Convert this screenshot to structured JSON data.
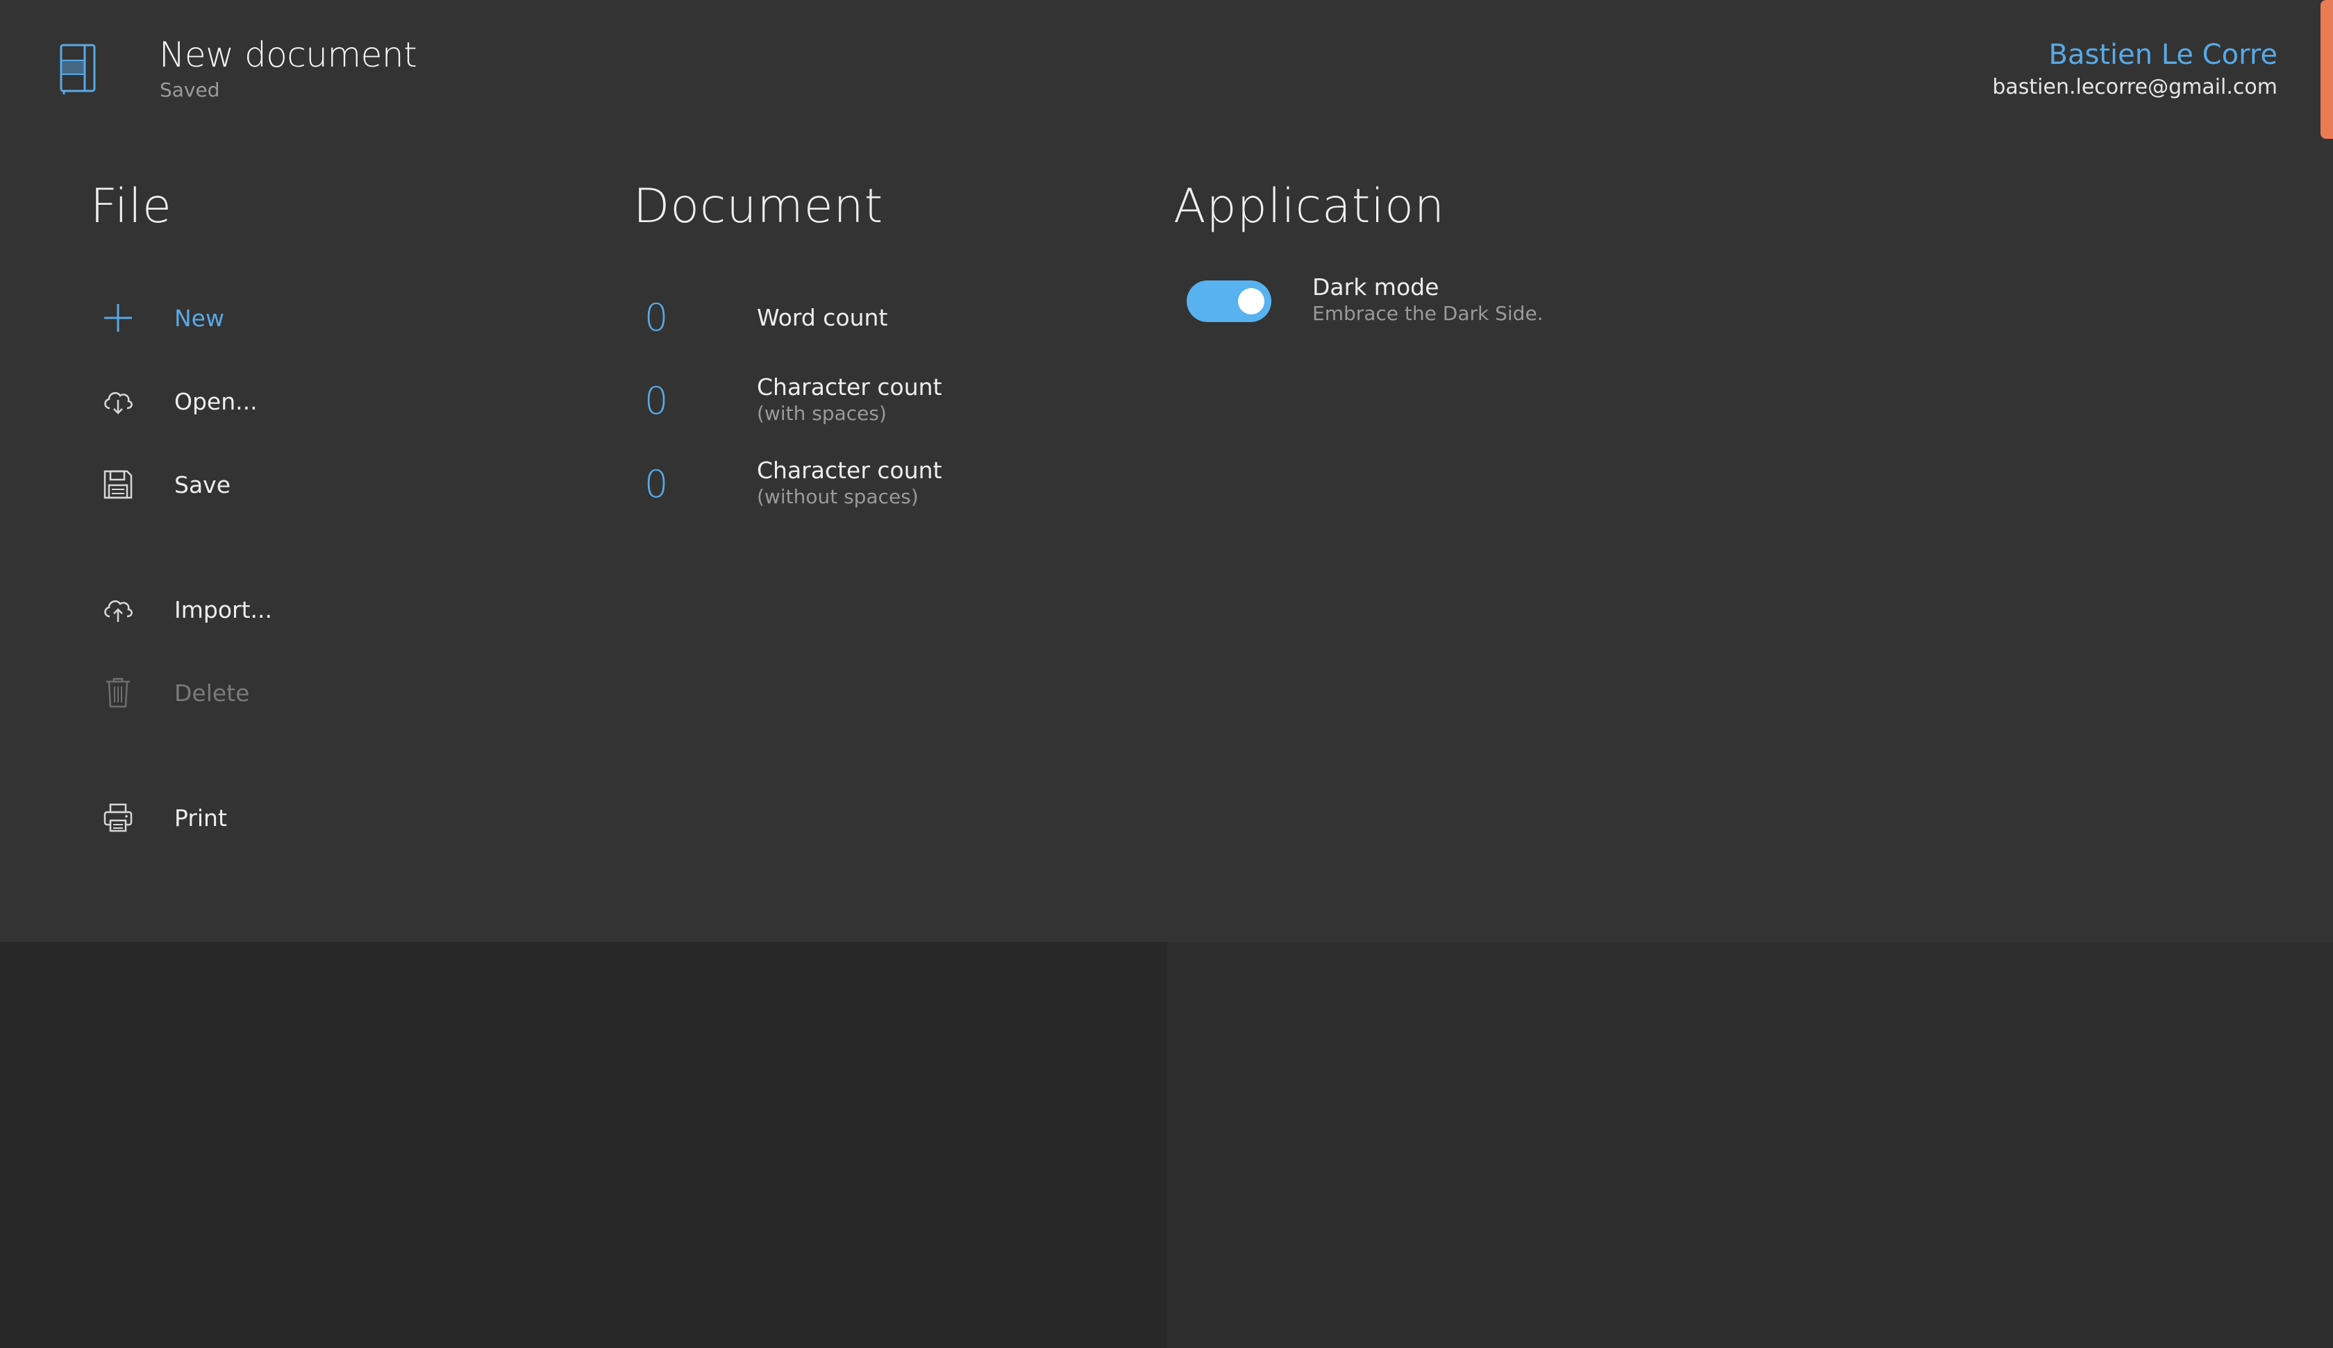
{
  "header": {
    "document_title": "New document",
    "document_status": "Saved",
    "user_name": "Bastien Le Corre",
    "user_email": "bastien.lecorre@gmail.com"
  },
  "colors": {
    "accent": "#58a9e6",
    "toggle_on": "#58b2f0",
    "orange_accent": "#ea7b54",
    "background": "#333333"
  },
  "file": {
    "title": "File",
    "items": [
      {
        "label": "New",
        "icon": "plus-icon",
        "state": "accent"
      },
      {
        "label": "Open...",
        "icon": "cloud-download-icon",
        "state": "normal"
      },
      {
        "label": "Save",
        "icon": "floppy-disk-icon",
        "state": "normal"
      },
      {
        "label": "Import...",
        "icon": "cloud-upload-icon",
        "state": "normal"
      },
      {
        "label": "Delete",
        "icon": "trash-icon",
        "state": "disabled"
      },
      {
        "label": "Print",
        "icon": "printer-icon",
        "state": "normal"
      }
    ]
  },
  "document": {
    "title": "Document",
    "stats": [
      {
        "value": "0",
        "label": "Word count",
        "sub": ""
      },
      {
        "value": "0",
        "label": "Character count",
        "sub": "(with spaces)"
      },
      {
        "value": "0",
        "label": "Character count",
        "sub": "(without spaces)"
      }
    ]
  },
  "application": {
    "title": "Application",
    "dark_mode": {
      "label": "Dark mode",
      "description": "Embrace the Dark Side.",
      "enabled": true
    }
  }
}
